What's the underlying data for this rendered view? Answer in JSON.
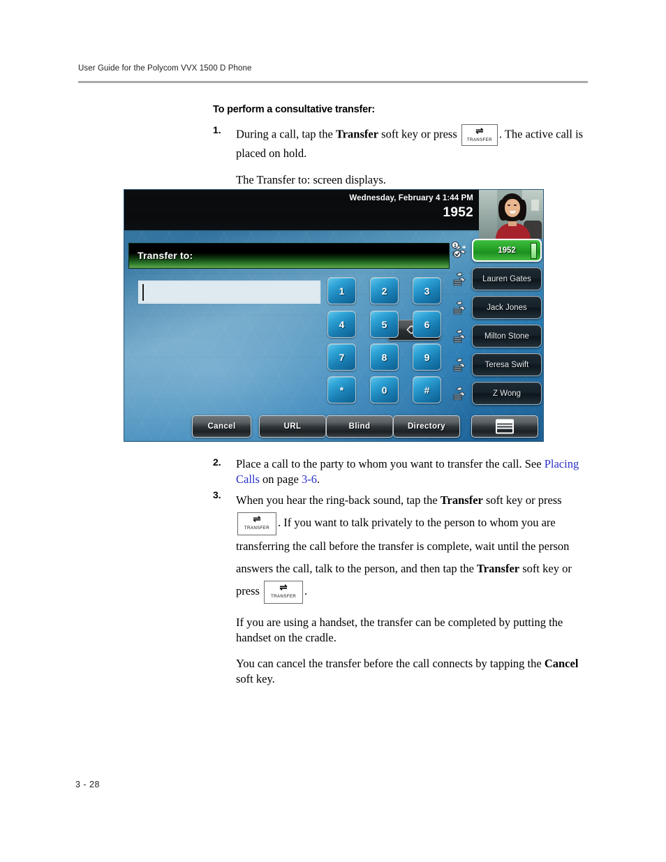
{
  "header": {
    "running_head": "User Guide for the Polycom VVX 1500 D Phone"
  },
  "section": {
    "heading": "To perform a consultative transfer:"
  },
  "steps": [
    {
      "num": "1.",
      "text_a": "During a call, tap the ",
      "bold_a": "Transfer",
      "text_b": " soft key or press ",
      "text_c": ". The active call is placed on hold.",
      "sub": "The Transfer to: screen displays."
    },
    {
      "num": "2.",
      "text_a": "Place a call to the party to whom you want to transfer the call. See ",
      "link_a": "Placing Calls",
      "text_b": " on page ",
      "link_b": "3-6",
      "text_c": "."
    },
    {
      "num": "3.",
      "text_a": "When you hear the ring-back sound, tap the ",
      "bold_a": "Transfer",
      "text_b": " soft key or press ",
      "text_c": ". If you want to talk privately to the person to whom you are transferring the call before the transfer is complete, wait until the person answers the call, talk to the person, and then tap the ",
      "bold_b": "Transfer",
      "text_d": " soft key or press ",
      "text_e": ".",
      "para2": "If you are using a handset, the transfer can be completed by putting the handset on the cradle.",
      "para3_a": "You can cancel the transfer before the call connects by tapping the ",
      "para3_bold": "Cancel",
      "para3_b": " soft key."
    }
  ],
  "transfer_key": {
    "arrows_glyph": "⇌",
    "label": "TRANSFER"
  },
  "phone": {
    "statusbar": {
      "date_time": "Wednesday, February 4  1:44 PM",
      "extension": "1952"
    },
    "banner": {
      "title": "Transfer to:"
    },
    "dial_field": {
      "value": "",
      "placeholder": ""
    },
    "backspace_key": {
      "glyph": "⌫",
      "name": "backspace"
    },
    "keypad": [
      "1",
      "2",
      "3",
      "4",
      "5",
      "6",
      "7",
      "8",
      "9",
      "*",
      "0",
      "#"
    ],
    "line_keys": [
      {
        "label": "1952",
        "active": true
      },
      {
        "label": "Lauren Gates",
        "active": false
      },
      {
        "label": "Jack Jones",
        "active": false
      },
      {
        "label": "Milton Stone",
        "active": false
      },
      {
        "label": "Teresa Swift",
        "active": false
      },
      {
        "label": "Z Wong",
        "active": false
      }
    ],
    "soft_keys": [
      {
        "label": "Cancel",
        "icon": ""
      },
      {
        "label": "URL",
        "icon": ""
      },
      {
        "label": "Blind",
        "icon": ""
      },
      {
        "label": "Directory",
        "icon": ""
      },
      {
        "label": "",
        "icon": "menu-icon"
      }
    ],
    "colors": {
      "banner_green": "#2e7b2c",
      "active_line_green": "#27a329",
      "screen_blue": "#2a7db5",
      "statusbar_black": "#0b0d0f"
    }
  },
  "footer": {
    "page_number": "3 - 28"
  }
}
